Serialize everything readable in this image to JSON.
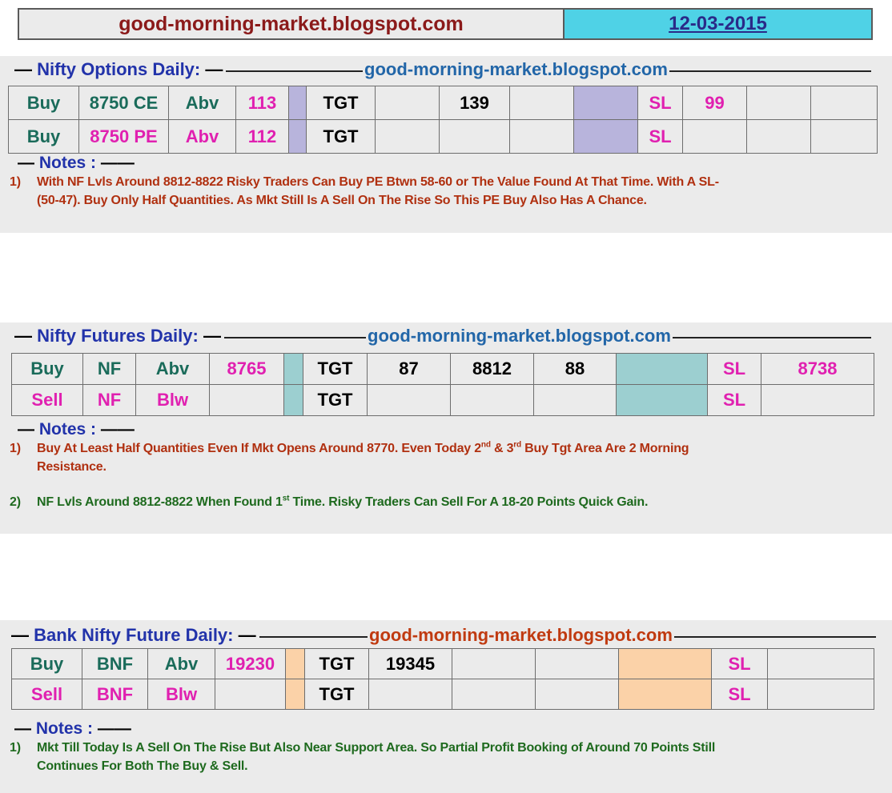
{
  "header": {
    "site": "good-morning-market.blogspot.com",
    "date": "12-03-2015"
  },
  "sections": [
    {
      "title": "Nifty  Options  Daily:",
      "site": "good-morning-market.blogspot.com",
      "site_color": "#2266a8",
      "rows": [
        [
          "Buy",
          "8750 CE",
          "Abv",
          "113",
          "",
          "TGT",
          "",
          "139",
          "",
          "",
          "SL",
          "99",
          "",
          ""
        ],
        [
          "Buy",
          "8750 PE",
          "Abv",
          "112",
          "",
          "TGT",
          "",
          "",
          "",
          "",
          "SL",
          "",
          "",
          ""
        ]
      ],
      "accent": "#b8b4dc",
      "notes_label": "Notes :",
      "notes": [
        {
          "n": "1)",
          "lines": [
            "With NF Lvls Around 8812-8822  Risky Traders Can Buy PE Btwn 58-60  or The Value Found At That Time. With A SL-",
            "(50-47).  Buy  Only Half Quantities.  As Mkt  Still Is A Sell On The Rise So  This PE Buy  Also Has A Chance."
          ],
          "color": "red"
        }
      ]
    },
    {
      "title": "Nifty Futures  Daily:",
      "site": "good-morning-market.blogspot.com",
      "site_color": "#2266a8",
      "rows": [
        [
          "Buy",
          "NF",
          "Abv",
          "8765",
          "",
          "TGT",
          "87",
          "8812",
          "88",
          "",
          "SL",
          "8738"
        ],
        [
          "Sell",
          "NF",
          "Blw",
          "",
          "",
          "TGT",
          "",
          "",
          "",
          "",
          "SL",
          ""
        ]
      ],
      "accent": "#9ccfd0",
      "notes_label": "Notes :",
      "notes": [
        {
          "n": "1)",
          "lines": [
            "Buy At Least Half Quantities Even If Mkt  Opens Around 8770.  Even Today 2nd & 3rd Buy Tgt Area Are 2  Morning",
            "Resistance."
          ],
          "color": "red"
        },
        {
          "n": "2)",
          "lines": [
            "NF Lvls Around 8812-8822 When Found 1st Time. Risky Traders Can Sell For A 18-20 Points Quick Gain."
          ],
          "color": "green"
        }
      ]
    },
    {
      "title": "Bank Nifty Future  Daily:",
      "site": "good-morning-market.blogspot.com",
      "site_color": "#c03a10",
      "rows": [
        [
          "Buy",
          "BNF",
          "Abv",
          "19230",
          "",
          "TGT",
          "19345",
          "",
          "",
          "",
          "SL",
          ""
        ],
        [
          "Sell",
          "BNF",
          "Blw",
          "",
          "",
          "TGT",
          "",
          "",
          "",
          "",
          "SL",
          ""
        ]
      ],
      "accent": "#fbd2a8",
      "notes_label": "Notes :",
      "notes": [
        {
          "n": "1)",
          "lines": [
            "Mkt Till Today Is A Sell On The Rise But Also Near Support Area.   So Partial Profit Booking  of  Around 70 Points Still",
            "Continues For Both The Buy & Sell."
          ],
          "color": "green"
        }
      ]
    }
  ]
}
